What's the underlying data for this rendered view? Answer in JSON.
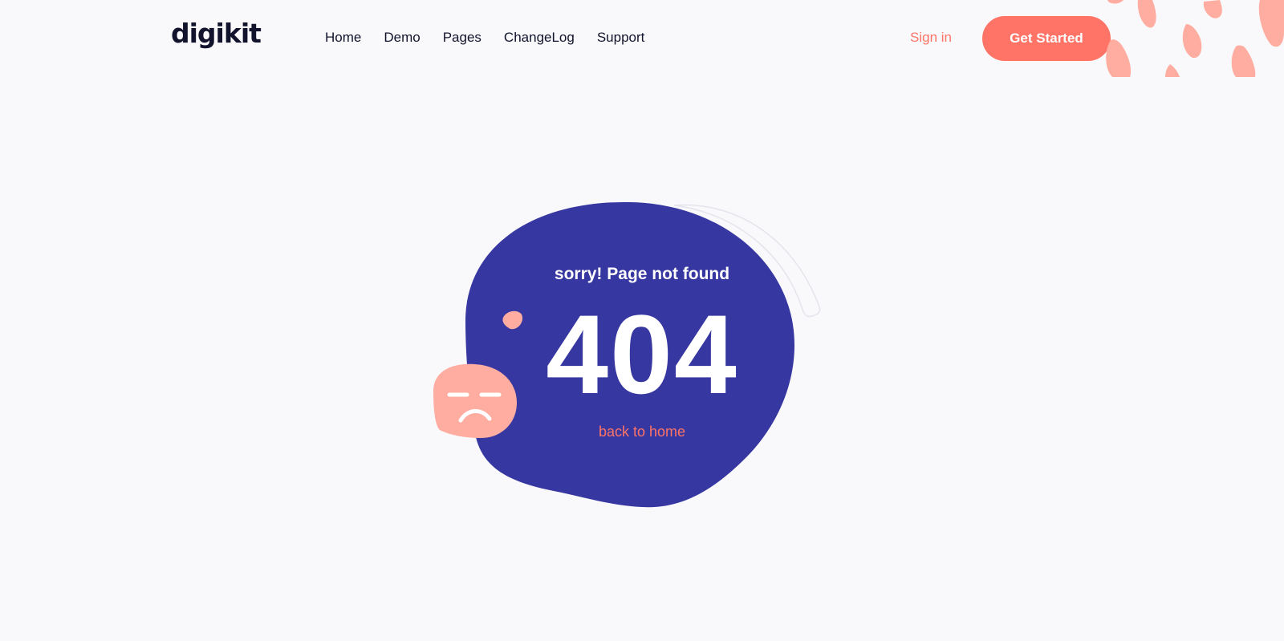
{
  "brand": {
    "logo_text": "digikit"
  },
  "nav": {
    "items": [
      {
        "label": "Home"
      },
      {
        "label": "Demo"
      },
      {
        "label": "Pages"
      },
      {
        "label": "ChangeLog"
      },
      {
        "label": "Support"
      }
    ]
  },
  "header": {
    "sign_in_label": "Sign in",
    "cta_label": "Get Started"
  },
  "error": {
    "message": "sorry! Page not found",
    "code": "404",
    "back_link_label": "back to home"
  },
  "colors": {
    "accent": "#ff7466",
    "blob": "#3737a1",
    "sad_face": "#ffada0",
    "text_dark": "#12142d",
    "background": "#f9f9fb"
  },
  "icons": {
    "sad_face": "sad-face-icon",
    "decor": "drop-decoration-icon"
  }
}
